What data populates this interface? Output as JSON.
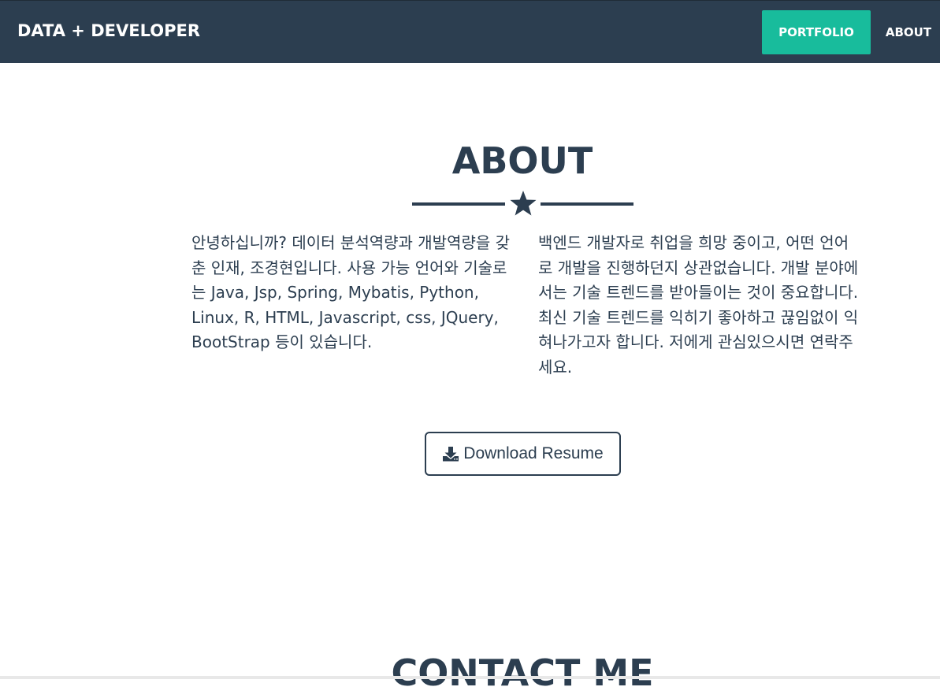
{
  "navbar": {
    "brand": "DATA + DEVELOPER",
    "items": [
      {
        "label": "PORTFOLIO",
        "active": true
      },
      {
        "label": "ABOUT",
        "active": false
      }
    ]
  },
  "about": {
    "title": "ABOUT",
    "paragraph_left": "안녕하십니까? 데이터 분석역량과 개발역량을 갖춘 인재, 조경현입니다. 사용 가능 언어와 기술로는 Java, Jsp, Spring, Mybatis, Python, Linux, R, HTML, Javascript, css, JQuery, BootStrap 등이 있습니다.",
    "paragraph_right": "백엔드 개발자로 취업을 희망 중이고, 어떤 언어로 개발을 진행하던지 상관없습니다. 개발 분야에서는 기술 트렌드를 받아들이는 것이 중요합니다. 최신 기술 트렌드를 익히기 좋아하고 끊임없이 익혀나가고자 합니다. 저에게 관심있으시면 연락주세요.",
    "download_button": "Download Resume"
  },
  "contact": {
    "title": "CONTACT ME"
  },
  "colors": {
    "primary": "#2c3e50",
    "accent": "#18bc9c",
    "background": "#ffffff"
  },
  "icons": {
    "divider": "star-icon",
    "download": "download-icon"
  }
}
